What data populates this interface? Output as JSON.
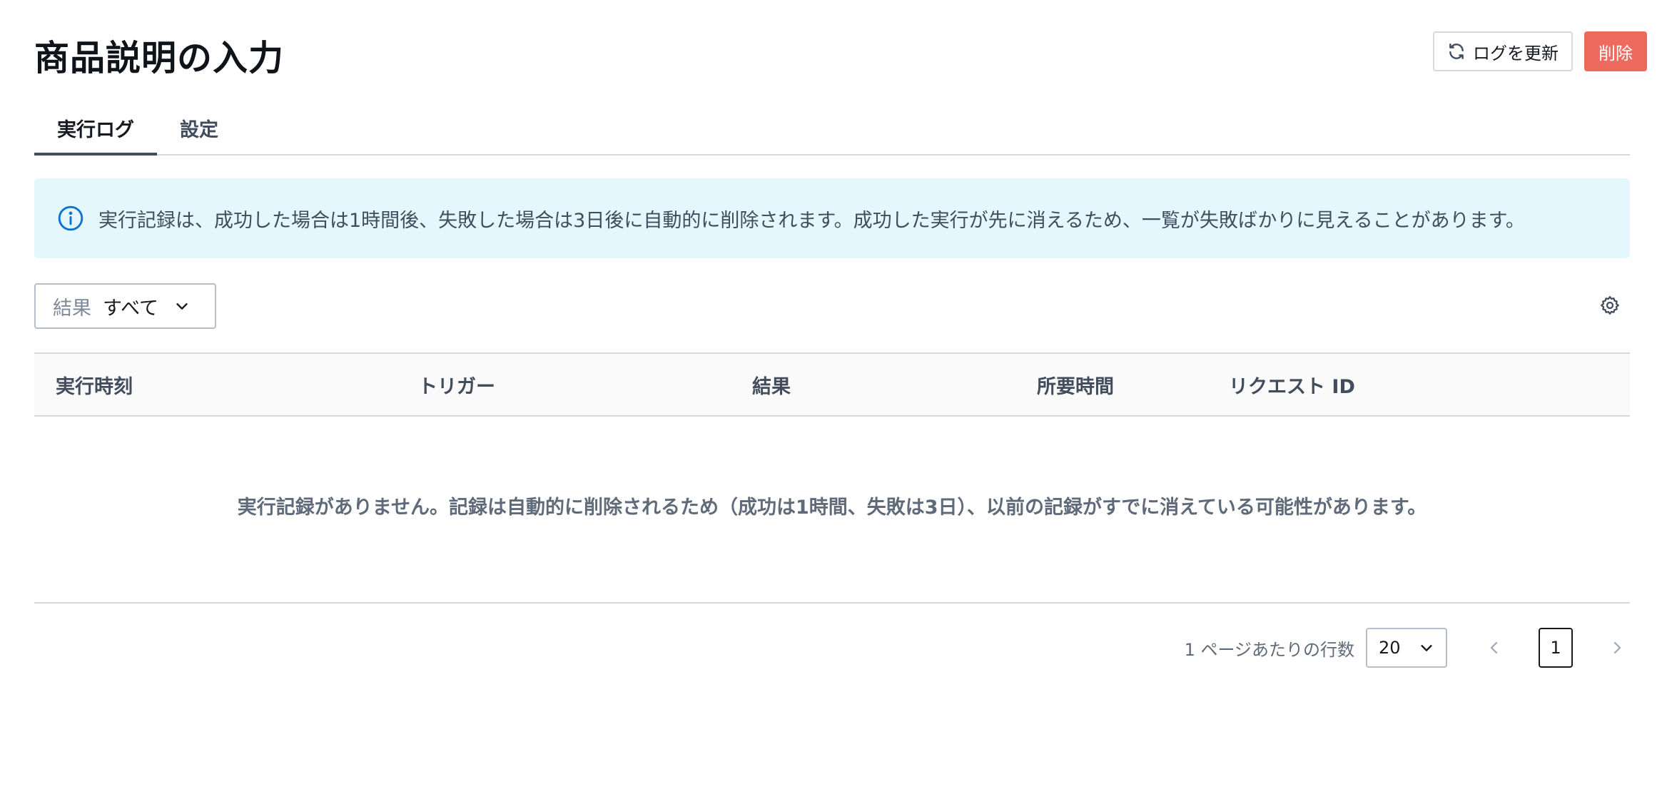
{
  "header": {
    "title": "商品説明の入力",
    "refresh_label": "ログを更新",
    "delete_label": "削除"
  },
  "tabs": [
    {
      "label": "実行ログ",
      "active": true
    },
    {
      "label": "設定",
      "active": false
    }
  ],
  "alert": {
    "icon": "info-icon",
    "text": "実行記録は、成功した場合は1時間後、失敗した場合は3日後に自動的に削除されます。成功した実行が先に消えるため、一覧が失敗ばかりに見えることがあります。"
  },
  "filter": {
    "label": "結果",
    "value": "すべて"
  },
  "table": {
    "columns": [
      "実行時刻",
      "トリガー",
      "結果",
      "所要時間",
      "リクエスト ID"
    ],
    "empty_message": "実行記録がありません。記録は自動的に削除されるため（成功は1時間、失敗は3日）、以前の記録がすでに消えている可能性があります。"
  },
  "pagination": {
    "rows_per_page_label": "1 ページあたりの行数",
    "rows_per_page": "20",
    "current_page": "1"
  },
  "colors": {
    "delete": "#ed6a5e",
    "alert_bg": "#e3f7fc",
    "info_icon": "#0972d3"
  }
}
